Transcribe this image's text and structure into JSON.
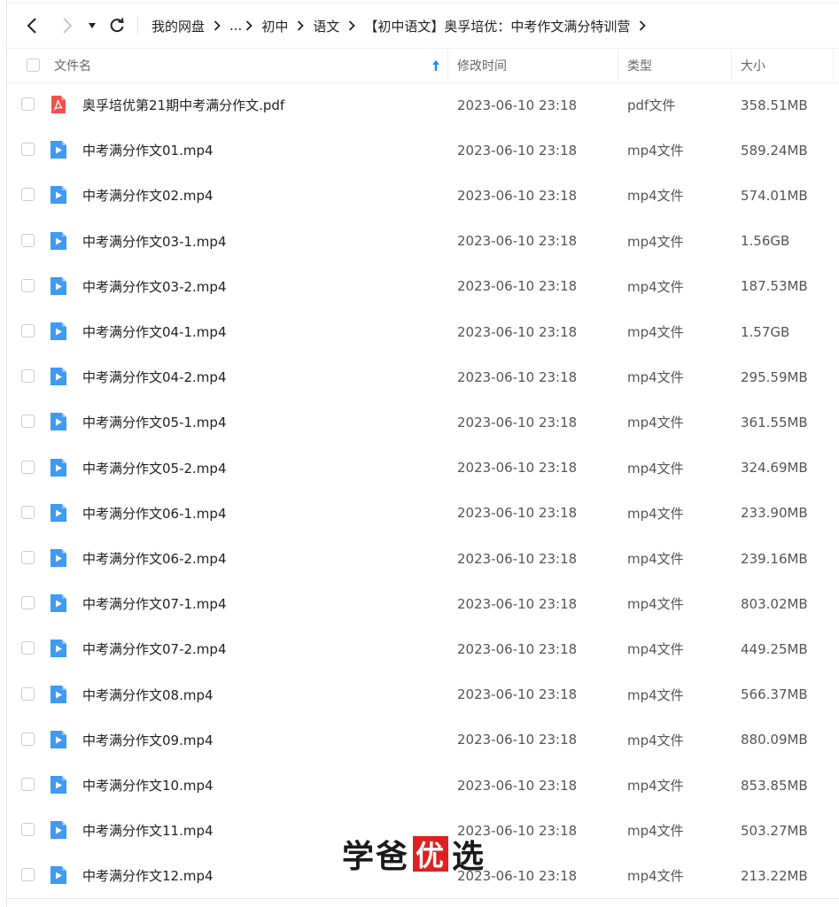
{
  "breadcrumb": {
    "items": [
      "我的网盘",
      "...",
      "初中",
      "语文",
      "【初中语文】奥孚培优：中考作文满分特训营"
    ]
  },
  "columns": {
    "name": "文件名",
    "modified": "修改时间",
    "type": "类型",
    "size": "大小"
  },
  "files": [
    {
      "name": "奥孚培优第21期中考满分作文.pdf",
      "modified": "2023-06-10 23:18",
      "type": "pdf文件",
      "size": "358.51MB",
      "icon": "pdf-icon"
    },
    {
      "name": "中考满分作文01.mp4",
      "modified": "2023-06-10 23:18",
      "type": "mp4文件",
      "size": "589.24MB",
      "icon": "video-icon"
    },
    {
      "name": "中考满分作文02.mp4",
      "modified": "2023-06-10 23:18",
      "type": "mp4文件",
      "size": "574.01MB",
      "icon": "video-icon"
    },
    {
      "name": "中考满分作文03-1.mp4",
      "modified": "2023-06-10 23:18",
      "type": "mp4文件",
      "size": "1.56GB",
      "icon": "video-icon"
    },
    {
      "name": "中考满分作文03-2.mp4",
      "modified": "2023-06-10 23:18",
      "type": "mp4文件",
      "size": "187.53MB",
      "icon": "video-icon"
    },
    {
      "name": "中考满分作文04-1.mp4",
      "modified": "2023-06-10 23:18",
      "type": "mp4文件",
      "size": "1.57GB",
      "icon": "video-icon"
    },
    {
      "name": "中考满分作文04-2.mp4",
      "modified": "2023-06-10 23:18",
      "type": "mp4文件",
      "size": "295.59MB",
      "icon": "video-icon"
    },
    {
      "name": "中考满分作文05-1.mp4",
      "modified": "2023-06-10 23:18",
      "type": "mp4文件",
      "size": "361.55MB",
      "icon": "video-icon"
    },
    {
      "name": "中考满分作文05-2.mp4",
      "modified": "2023-06-10 23:18",
      "type": "mp4文件",
      "size": "324.69MB",
      "icon": "video-icon"
    },
    {
      "name": "中考满分作文06-1.mp4",
      "modified": "2023-06-10 23:18",
      "type": "mp4文件",
      "size": "233.90MB",
      "icon": "video-icon"
    },
    {
      "name": "中考满分作文06-2.mp4",
      "modified": "2023-06-10 23:18",
      "type": "mp4文件",
      "size": "239.16MB",
      "icon": "video-icon"
    },
    {
      "name": "中考满分作文07-1.mp4",
      "modified": "2023-06-10 23:18",
      "type": "mp4文件",
      "size": "803.02MB",
      "icon": "video-icon"
    },
    {
      "name": "中考满分作文07-2.mp4",
      "modified": "2023-06-10 23:18",
      "type": "mp4文件",
      "size": "449.25MB",
      "icon": "video-icon"
    },
    {
      "name": "中考满分作文08.mp4",
      "modified": "2023-06-10 23:18",
      "type": "mp4文件",
      "size": "566.37MB",
      "icon": "video-icon"
    },
    {
      "name": "中考满分作文09.mp4",
      "modified": "2023-06-10 23:18",
      "type": "mp4文件",
      "size": "880.09MB",
      "icon": "video-icon"
    },
    {
      "name": "中考满分作文10.mp4",
      "modified": "2023-06-10 23:18",
      "type": "mp4文件",
      "size": "853.85MB",
      "icon": "video-icon"
    },
    {
      "name": "中考满分作文11.mp4",
      "modified": "2023-06-10 23:18",
      "type": "mp4文件",
      "size": "503.27MB",
      "icon": "video-icon"
    },
    {
      "name": "中考满分作文12.mp4",
      "modified": "2023-06-10 23:18",
      "type": "mp4文件",
      "size": "213.22MB",
      "icon": "video-icon"
    }
  ],
  "watermark": {
    "chars": [
      "学",
      "爸",
      "优",
      "选"
    ]
  },
  "colors": {
    "video_icon": "#3d9af5",
    "pdf_icon": "#f0514f",
    "sort_arrow": "#1e88f5",
    "seal": "#e02020"
  }
}
